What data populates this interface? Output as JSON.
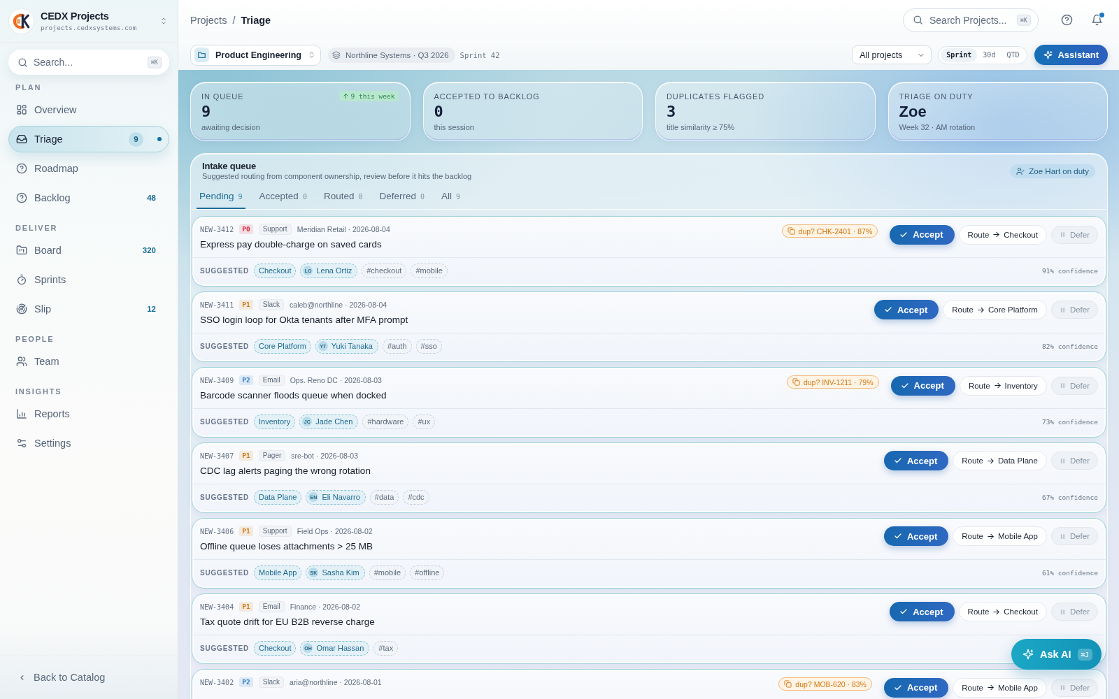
{
  "sidebar": {
    "brand": {
      "name": "CEDX Projects",
      "domain": "projects.cedxsystems.com"
    },
    "search": {
      "placeholder": "Search...",
      "shortcut": "⌘K"
    },
    "sections": [
      {
        "label": "PLAN",
        "items": [
          {
            "label": "Overview",
            "selected": false,
            "dot": false
          },
          {
            "label": "Triage",
            "selected": true,
            "count": "9",
            "dot": true
          },
          {
            "label": "Roadmap",
            "selected": false,
            "dot": false
          },
          {
            "label": "Backlog",
            "selected": false,
            "count": "48",
            "dot": false
          }
        ]
      },
      {
        "label": "DELIVER",
        "items": [
          {
            "label": "Board",
            "selected": false,
            "count": "320",
            "dot": false
          },
          {
            "label": "Sprints",
            "selected": false,
            "dot": false
          },
          {
            "label": "Slip",
            "selected": false,
            "count": "12",
            "dot": false
          }
        ]
      },
      {
        "label": "PEOPLE",
        "items": [
          {
            "label": "Team",
            "selected": false,
            "dot": false
          }
        ]
      },
      {
        "label": "INSIGHTS",
        "items": [
          {
            "label": "Reports",
            "selected": false,
            "dot": false
          },
          {
            "label": "Settings",
            "selected": false,
            "dot": false
          }
        ]
      }
    ],
    "footer": {
      "label": "Back to Catalog"
    }
  },
  "header": {
    "breadcrumb": [
      {
        "label": "Projects",
        "current": false
      },
      {
        "label": "Triage",
        "current": true
      }
    ],
    "separator": "/",
    "search": {
      "placeholder": "Search Projects...",
      "shortcut": "⌘K"
    },
    "notifications": {
      "unread": true
    }
  },
  "toolbar": {
    "workspace": "Product Engineering",
    "context": "Northline Systems · Q3 2026",
    "sprint": "Sprint 42",
    "project_filter": "All projects",
    "ranges": [
      {
        "label": "Sprint",
        "selected": true
      },
      {
        "label": "30d",
        "selected": false
      },
      {
        "label": "QTD",
        "selected": false
      }
    ],
    "assistant": "Assistant"
  },
  "stats": [
    {
      "kind": "count",
      "label": "IN QUEUE",
      "value": "9",
      "caption": "awaiting decision",
      "trend": "9 this week"
    },
    {
      "kind": "count",
      "label": "ACCEPTED TO BACKLOG",
      "value": "0",
      "caption": "this session"
    },
    {
      "kind": "count",
      "label": "DUPLICATES FLAGGED",
      "value": "3",
      "caption": "title similarity ≥ 75%"
    },
    {
      "kind": "person",
      "label": "TRIAGE ON DUTY",
      "value": "Zoe",
      "caption": "Week 32 · AM rotation"
    }
  ],
  "intake": {
    "title": "Intake queue",
    "subtitle": "Suggested routing from component ownership, review before it hits the backlog",
    "on_duty": "Zoe Hart on duty",
    "tabs": [
      {
        "label": "Pending",
        "count": "9",
        "selected": true
      },
      {
        "label": "Accepted",
        "count": "0",
        "selected": false
      },
      {
        "label": "Routed",
        "count": "0",
        "selected": false
      },
      {
        "label": "Deferred",
        "count": "0",
        "selected": false
      },
      {
        "label": "All",
        "count": "9",
        "selected": false
      }
    ],
    "rows": [
      {
        "id": "NEW-3412",
        "priority": {
          "label": "P0",
          "color": "#d7263d"
        },
        "source": "Support",
        "meta": "Meridian Retail · 2026-08-04",
        "title": "Express pay double-charge on saved cards",
        "duplicate": "dup? CHK-2401 · 87%",
        "accept": "Accept",
        "route": "Route",
        "route_to": "Checkout",
        "defer": "Defer",
        "suggested_label": "SUGGESTED",
        "component": "Checkout",
        "assignee": {
          "initials": "LO",
          "name": "Lena Ortiz"
        },
        "tags": [
          "#checkout",
          "#mobile"
        ],
        "confidence": "91% confidence"
      },
      {
        "id": "NEW-3411",
        "priority": {
          "label": "P1",
          "color": "#d0790f"
        },
        "source": "Slack",
        "meta": "caleb@northline · 2026-08-04",
        "title": "SSO login loop for Okta tenants after MFA prompt",
        "accept": "Accept",
        "route": "Route",
        "route_to": "Core Platform",
        "defer": "Defer",
        "suggested_label": "SUGGESTED",
        "component": "Core Platform",
        "assignee": {
          "initials": "YT",
          "name": "Yuki Tanaka"
        },
        "tags": [
          "#auth",
          "#sso"
        ],
        "confidence": "82% confidence"
      },
      {
        "id": "NEW-3409",
        "priority": {
          "label": "P2",
          "color": "#2a7ec6"
        },
        "source": "Email",
        "meta": "Ops. Reno DC · 2026-08-03",
        "title": "Barcode scanner floods queue when docked",
        "duplicate": "dup? INV-1211 · 79%",
        "accept": "Accept",
        "route": "Route",
        "route_to": "Inventory",
        "defer": "Defer",
        "suggested_label": "SUGGESTED",
        "component": "Inventory",
        "assignee": {
          "initials": "JC",
          "name": "Jade Chen"
        },
        "tags": [
          "#hardware",
          "#ux"
        ],
        "confidence": "73% confidence"
      },
      {
        "id": "NEW-3407",
        "priority": {
          "label": "P1",
          "color": "#d0790f"
        },
        "source": "Pager",
        "meta": "sre-bot · 2026-08-03",
        "title": "CDC lag alerts paging the wrong rotation",
        "accept": "Accept",
        "route": "Route",
        "route_to": "Data Plane",
        "defer": "Defer",
        "suggested_label": "SUGGESTED",
        "component": "Data Plane",
        "assignee": {
          "initials": "EN",
          "name": "Eli Navarro"
        },
        "tags": [
          "#data",
          "#cdc"
        ],
        "confidence": "67% confidence"
      },
      {
        "id": "NEW-3406",
        "priority": {
          "label": "P1",
          "color": "#d0790f"
        },
        "source": "Support",
        "meta": "Field Ops · 2026-08-02",
        "title": "Offline queue loses attachments > 25 MB",
        "accept": "Accept",
        "route": "Route",
        "route_to": "Mobile App",
        "defer": "Defer",
        "suggested_label": "SUGGESTED",
        "component": "Mobile App",
        "assignee": {
          "initials": "SK",
          "name": "Sasha Kim"
        },
        "tags": [
          "#mobile",
          "#offline"
        ],
        "confidence": "61% confidence"
      },
      {
        "id": "NEW-3404",
        "priority": {
          "label": "P1",
          "color": "#d0790f"
        },
        "source": "Email",
        "meta": "Finance · 2026-08-02",
        "title": "Tax quote drift for EU B2B reverse charge",
        "accept": "Accept",
        "route": "Route",
        "route_to": "Checkout",
        "defer": "Defer",
        "suggested_label": "SUGGESTED",
        "component": "Checkout",
        "assignee": {
          "initials": "OH",
          "name": "Omar Hassan"
        },
        "tags": [
          "#tax"
        ]
      },
      {
        "id": "NEW-3402",
        "priority": {
          "label": "P2",
          "color": "#2a7ec6"
        },
        "source": "Slack",
        "meta": "aria@northline · 2026-08-01",
        "duplicate": "dup? MOB-620 · 83%",
        "accept": "Accept",
        "route": "Route",
        "route_to": "Mobile App",
        "defer": "Defer"
      }
    ]
  },
  "ask_ai": {
    "label": "Ask AI",
    "shortcut": "⌘J"
  }
}
